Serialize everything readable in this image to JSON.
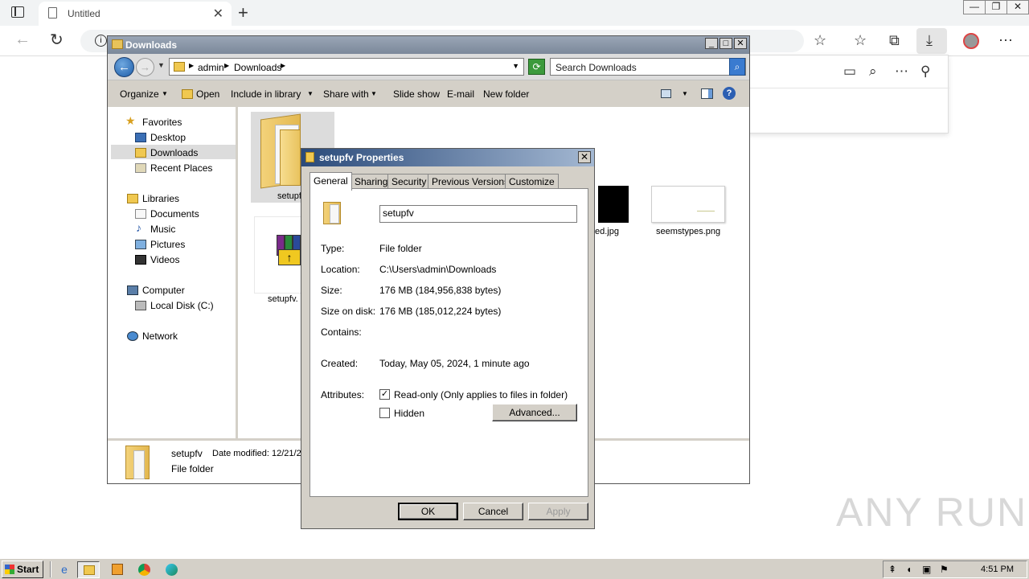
{
  "browser": {
    "tab_title": "Untitled",
    "close_tab": "✕",
    "new_tab": "+",
    "win_controls": [
      "—",
      "❐",
      "✕"
    ]
  },
  "explorer": {
    "title": "Downloads",
    "breadcrumb": [
      "admin",
      "Downloads"
    ],
    "search_placeholder": "Search Downloads",
    "commands": {
      "organize": "Organize",
      "open": "Open",
      "include": "Include in library",
      "share": "Share with",
      "slideshow": "Slide show",
      "email": "E-mail",
      "new_folder": "New folder"
    },
    "nav": {
      "favorites": "Favorites",
      "desktop": "Desktop",
      "downloads": "Downloads",
      "recent": "Recent Places",
      "libraries": "Libraries",
      "documents": "Documents",
      "music": "Music",
      "pictures": "Pictures",
      "videos": "Videos",
      "computer": "Computer",
      "local_disk": "Local Disk (C:)",
      "network": "Network"
    },
    "files": {
      "folder": "setupf",
      "archive": "setupfv.",
      "jpg": "ed.jpg",
      "png": "seemstypes.png"
    },
    "details": {
      "name": "setupfv",
      "modified": "Date modified: 12/21/2",
      "type": "File folder"
    }
  },
  "properties": {
    "title": "setupfv Properties",
    "tabs": [
      "General",
      "Sharing",
      "Security",
      "Previous Versions",
      "Customize"
    ],
    "name": "setupfv",
    "labels": {
      "type": "Type:",
      "location": "Location:",
      "size": "Size:",
      "size_on_disk": "Size on disk:",
      "contains": "Contains:",
      "created": "Created:",
      "attributes": "Attributes:"
    },
    "values": {
      "type": "File folder",
      "location": "C:\\Users\\admin\\Downloads",
      "size": "176 MB (184,956,838 bytes)",
      "size_on_disk": "176 MB (185,012,224 bytes)",
      "contains": "",
      "created": "Today, May 05, 2024, 1 minute ago"
    },
    "readonly_label": "Read-only (Only applies to files in folder)",
    "readonly_checked": true,
    "hidden_label": "Hidden",
    "hidden_checked": false,
    "advanced": "Advanced...",
    "ok": "OK",
    "cancel": "Cancel",
    "apply": "Apply"
  },
  "taskbar": {
    "start": "Start",
    "clock": "4:51 PM"
  },
  "watermark": "ANY RUN"
}
